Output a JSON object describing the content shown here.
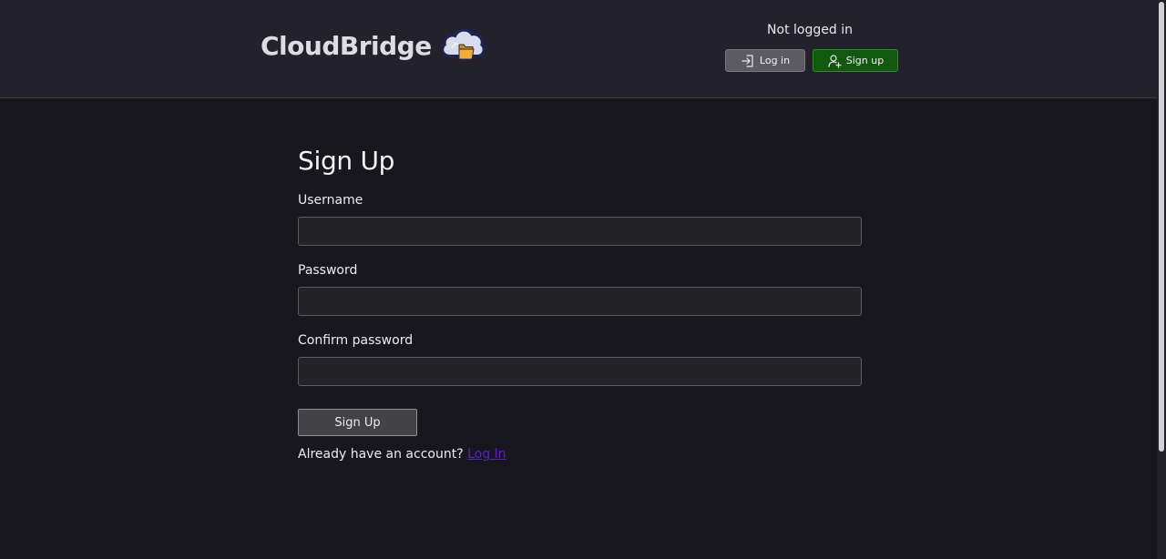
{
  "header": {
    "brand_name": "CloudBridge",
    "auth_status": "Not logged in",
    "login_label": "Log in",
    "signup_label": "Sign up"
  },
  "form": {
    "title": "Sign Up",
    "fields": [
      {
        "label": "Username",
        "value": "",
        "placeholder": ""
      },
      {
        "label": "Password",
        "value": "",
        "placeholder": ""
      },
      {
        "label": "Confirm password",
        "value": "",
        "placeholder": ""
      }
    ],
    "submit_label": "Sign Up",
    "footer_text": "Already have an account?",
    "footer_link": "Log In"
  },
  "icons": {
    "login": "login-arrow-icon",
    "signup": "user-plus-icon",
    "logo": "cloud-folder-icon"
  },
  "colors": {
    "page_bg": "#18171d",
    "header_bg": "#23222c",
    "signup_button": "#12580f",
    "login_button": "#5b5b61",
    "link": "#5a1fc6"
  }
}
